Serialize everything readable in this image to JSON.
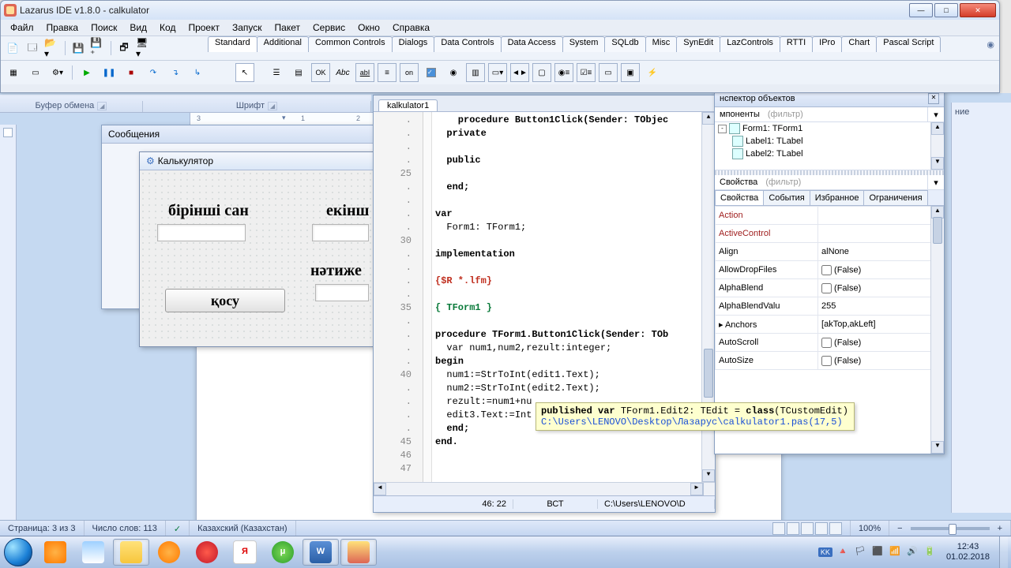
{
  "ide": {
    "title": "Lazarus IDE v1.8.0 - calkulator",
    "menu": [
      "Файл",
      "Правка",
      "Поиск",
      "Вид",
      "Код",
      "Проект",
      "Запуск",
      "Пакет",
      "Сервис",
      "Окно",
      "Справка"
    ],
    "palette_tabs": [
      "Standard",
      "Additional",
      "Common Controls",
      "Dialogs",
      "Data Controls",
      "Data Access",
      "System",
      "SQLdb",
      "Misc",
      "SynEdit",
      "LazControls",
      "RTTI",
      "IPro",
      "Chart",
      "Pascal Script"
    ],
    "active_tab": "Standard"
  },
  "word_fragments": {
    "group_clipboard": "Буфер обмена",
    "group_font": "Шрифт",
    "right_label": "ние"
  },
  "messages": {
    "title": "Сообщения"
  },
  "form": {
    "title": "Калькулятор",
    "label1": "бірінші сан",
    "label2": "екінш",
    "label3": "нәтиже",
    "button": "қосу"
  },
  "source": {
    "tab": "kalkulator1",
    "status_pos": "46: 22",
    "status_ins": "ВСТ",
    "status_path": "C:\\Users\\LENOVO\\D",
    "gutter": ".\n.\n.\n.\n25\n.\n.\n.\n.\n30\n.\n.\n.\n.\n35\n.\n.\n.\n.\n40\n.\n.\n.\n.\n45\n46\n47",
    "lines": {
      "l1": "    procedure Button1Click(Sender: TObjec",
      "l2": "  private",
      "l3": "",
      "l4": "  public",
      "l5": "",
      "l6": "  end;",
      "l7": "",
      "l8": "var",
      "l9": "  Form1: TForm1;",
      "l10": "",
      "l11": "implementation",
      "l12": "",
      "l13": "{$R *.lfm}",
      "l14": "",
      "l15": "{ TForm1 }",
      "l16": "",
      "l17": "procedure TForm1.Button1Click(Sender: TOb",
      "l18": "  var num1,num2,rezult:integer;",
      "l19": "begin",
      "l20": "  num1:=StrToInt(edit1.Text);",
      "l21": "  num2:=StrToInt(edit2.Text);",
      "l22": "  rezult:=num1+nu",
      "l23": "  edit3.Text:=Int",
      "l24": "  end;",
      "l25": "end.",
      "l26": ""
    }
  },
  "hint": {
    "line1_pre": "published var ",
    "line1_mid": "TForm1.Edit2: TEdit = ",
    "line1_cls": "class",
    "line1_post": "(TCustomEdit)",
    "line2": "C:\\Users\\LENOVO\\Desktop\\Лазарус\\calkulator1.pas(17,5)"
  },
  "inspector": {
    "title": "нспектор объектов",
    "comp_label": "мпоненты",
    "filter_placeholder": "(фильтр)",
    "tree": [
      {
        "indent": 0,
        "exp": "-",
        "label": "Form1: TForm1"
      },
      {
        "indent": 1,
        "exp": "",
        "label": "Label1: TLabel"
      },
      {
        "indent": 1,
        "exp": "",
        "label": "Label2: TLabel"
      }
    ],
    "prop_label": "Свойства",
    "tabs": [
      "Свойства",
      "События",
      "Избранное",
      "Ограничения"
    ],
    "props": [
      {
        "name": "Action",
        "value": "",
        "red": true
      },
      {
        "name": "ActiveControl",
        "value": "",
        "red": true
      },
      {
        "name": "Align",
        "value": "alNone"
      },
      {
        "name": "AllowDropFiles",
        "value": "(False)",
        "check": true
      },
      {
        "name": "AlphaBlend",
        "value": "(False)",
        "check": true
      },
      {
        "name": "AlphaBlendValu",
        "value": "255"
      },
      {
        "name": "Anchors",
        "value": "[akTop,akLeft]",
        "expander": true
      },
      {
        "name": "AutoScroll",
        "value": "(False)",
        "check": true
      },
      {
        "name": "AutoSize",
        "value": "(False)",
        "check": true
      }
    ]
  },
  "word_status": {
    "page": "Страница: 3 из 3",
    "words": "Число слов: 113",
    "lang": "Казахский (Казахстан)",
    "zoom": "100%"
  },
  "taskbar": {
    "lang": "KK",
    "time": "12:43",
    "date": "01.02.2018"
  }
}
